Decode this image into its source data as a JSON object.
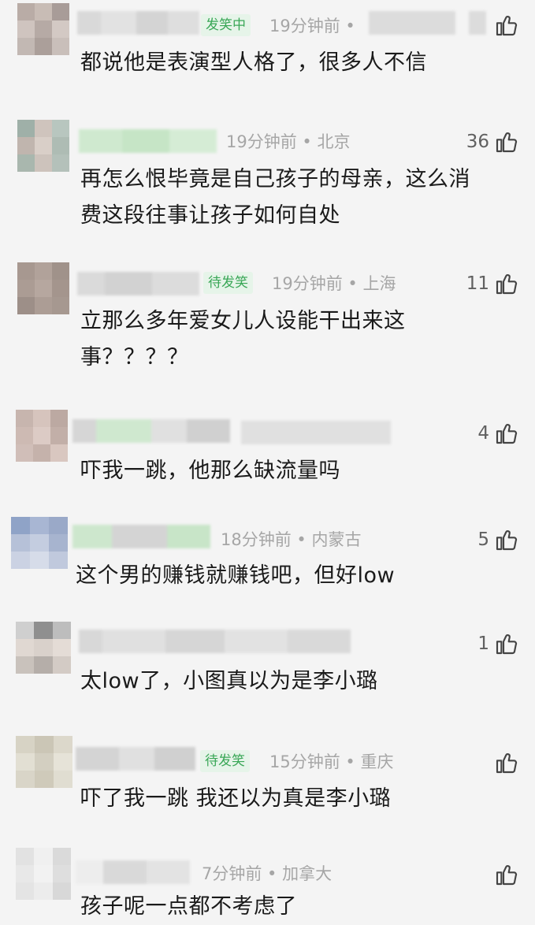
{
  "comments": [
    {
      "badge": "发笑中",
      "time": "19分钟前",
      "location": "",
      "likes": "",
      "lines": [
        "都说他是表演型人格了，很多人不信"
      ]
    },
    {
      "badge": "",
      "time": "19分钟前",
      "location": "北京",
      "likes": "36",
      "lines": [
        "再怎么恨毕竟是自己孩子的母亲，这么消",
        "费这段往事让孩子如何自处"
      ]
    },
    {
      "badge": "待发笑",
      "time": "19分钟前",
      "location": "上海",
      "likes": "11",
      "lines": [
        "立那么多年爱女儿人设能干出来这",
        "事？？？？"
      ]
    },
    {
      "badge": "",
      "time": "",
      "location": "",
      "likes": "4",
      "lines": [
        "吓我一跳，他那么缺流量吗"
      ]
    },
    {
      "badge": "",
      "time": "18分钟前",
      "location": "内蒙古",
      "likes": "5",
      "lines": [
        "这个男的赚钱就赚钱吧，但好low"
      ]
    },
    {
      "badge": "",
      "time": "",
      "location": "",
      "likes": "1",
      "lines": [
        "太low了，小图真以为是李小璐"
      ]
    },
    {
      "badge": "待发笑",
      "time": "15分钟前",
      "location": "重庆",
      "likes": "",
      "lines": [
        "吓了我一跳  我还以为真是李小璐"
      ]
    },
    {
      "badge": "",
      "time": "7分钟前",
      "location": "加拿大",
      "likes": "",
      "lines": [
        "孩子呢一点都不考虑了"
      ]
    }
  ],
  "separator": " • ",
  "icons": {
    "like": "thumbs-up-icon",
    "avatar": "blurred-avatar"
  },
  "colors": {
    "badge_text": "#3aa757",
    "badge_bg": "#e6f4e9",
    "meta": "#a6a6a6",
    "text": "#1a1a1a"
  }
}
